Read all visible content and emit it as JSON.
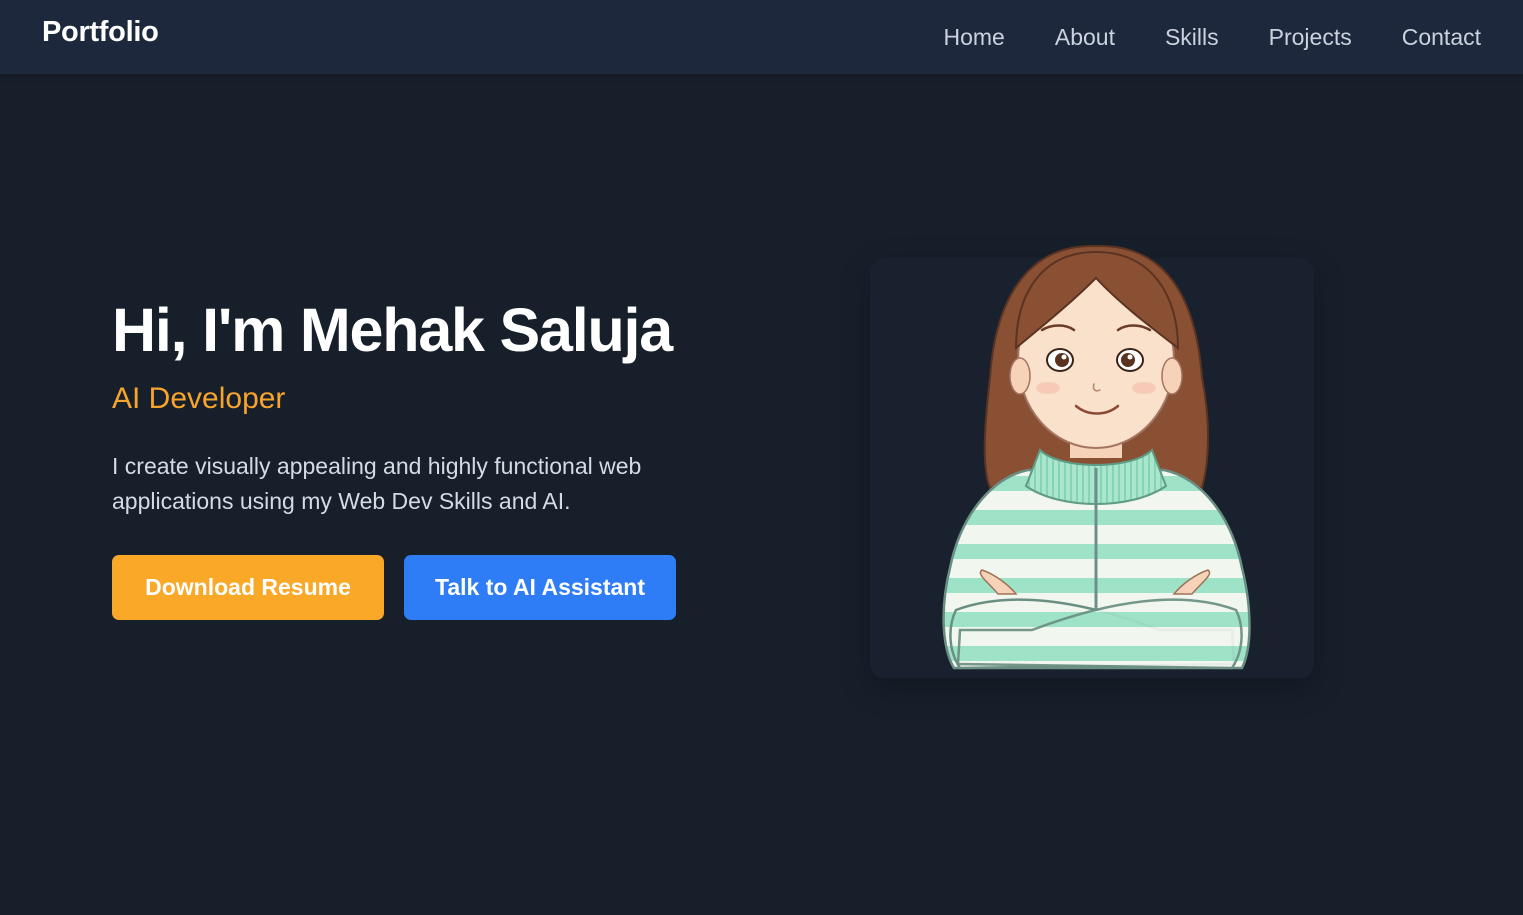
{
  "navbar": {
    "brand": "Portfolio",
    "links": [
      "Home",
      "About",
      "Skills",
      "Projects",
      "Contact"
    ]
  },
  "hero": {
    "title": "Hi, I'm Mehak Saluja",
    "role": "AI Developer",
    "description": "I create visually appealing and highly functional web applications using my Web Dev Skills and AI.",
    "buttons": {
      "resume": "Download Resume",
      "assistant": "Talk to AI Assistant"
    }
  },
  "colors": {
    "background": "#171f2b",
    "navbar": "#1d283d",
    "accent_orange": "#f9a828",
    "accent_blue": "#2f7df6"
  }
}
